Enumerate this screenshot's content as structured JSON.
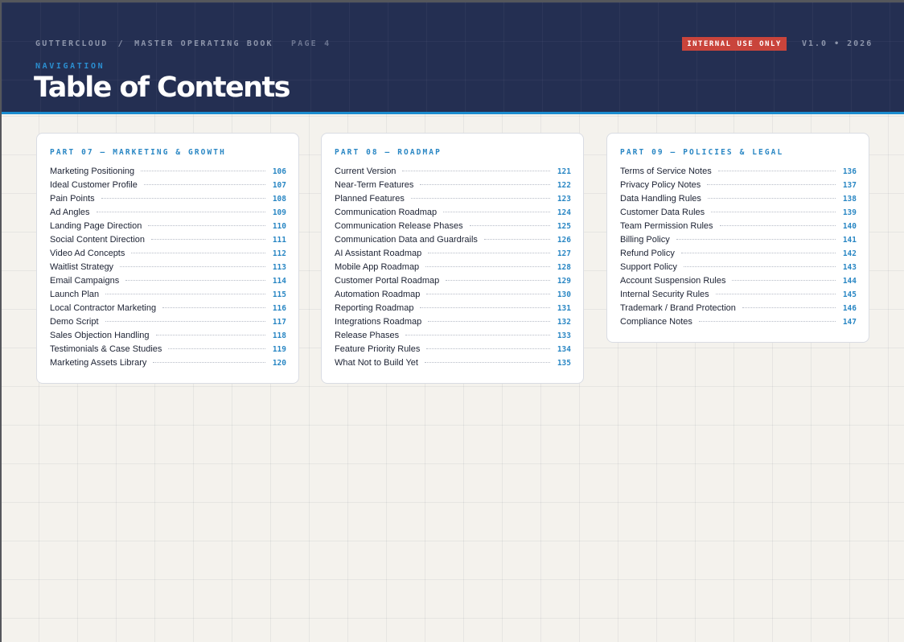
{
  "header": {
    "brand": "GUTTERCLOUD",
    "separator": "/",
    "book": "MASTER OPERATING BOOK",
    "page": "PAGE 4",
    "badge": "INTERNAL USE ONLY",
    "version": "V1.0 • 2026",
    "eyebrow": "NAVIGATION",
    "title": "Table of Contents"
  },
  "colors": {
    "header_bg": "#242f52",
    "accent_blue": "#2a87c4",
    "badge_red": "#c9443b",
    "page_bg": "#f4f2ed"
  },
  "parts": [
    {
      "title": "PART 07 — MARKETING & GROWTH",
      "items": [
        {
          "label": "Marketing Positioning",
          "page": "106"
        },
        {
          "label": "Ideal Customer Profile",
          "page": "107"
        },
        {
          "label": "Pain Points",
          "page": "108"
        },
        {
          "label": "Ad Angles",
          "page": "109"
        },
        {
          "label": "Landing Page Direction",
          "page": "110"
        },
        {
          "label": "Social Content Direction",
          "page": "111"
        },
        {
          "label": "Video Ad Concepts",
          "page": "112"
        },
        {
          "label": "Waitlist Strategy",
          "page": "113"
        },
        {
          "label": "Email Campaigns",
          "page": "114"
        },
        {
          "label": "Launch Plan",
          "page": "115"
        },
        {
          "label": "Local Contractor Marketing",
          "page": "116"
        },
        {
          "label": "Demo Script",
          "page": "117"
        },
        {
          "label": "Sales Objection Handling",
          "page": "118"
        },
        {
          "label": "Testimonials & Case Studies",
          "page": "119"
        },
        {
          "label": "Marketing Assets Library",
          "page": "120"
        }
      ]
    },
    {
      "title": "PART 08 — ROADMAP",
      "items": [
        {
          "label": "Current Version",
          "page": "121"
        },
        {
          "label": "Near-Term Features",
          "page": "122"
        },
        {
          "label": "Planned Features",
          "page": "123"
        },
        {
          "label": "Communication Roadmap",
          "page": "124"
        },
        {
          "label": "Communication Release Phases",
          "page": "125"
        },
        {
          "label": "Communication Data and Guardrails",
          "page": "126"
        },
        {
          "label": "AI Assistant Roadmap",
          "page": "127"
        },
        {
          "label": "Mobile App Roadmap",
          "page": "128"
        },
        {
          "label": "Customer Portal Roadmap",
          "page": "129"
        },
        {
          "label": "Automation Roadmap",
          "page": "130"
        },
        {
          "label": "Reporting Roadmap",
          "page": "131"
        },
        {
          "label": "Integrations Roadmap",
          "page": "132"
        },
        {
          "label": "Release Phases",
          "page": "133"
        },
        {
          "label": "Feature Priority Rules",
          "page": "134"
        },
        {
          "label": "What Not to Build Yet",
          "page": "135"
        }
      ]
    },
    {
      "title": "PART 09 — POLICIES & LEGAL",
      "items": [
        {
          "label": "Terms of Service Notes",
          "page": "136"
        },
        {
          "label": "Privacy Policy Notes",
          "page": "137"
        },
        {
          "label": "Data Handling Rules",
          "page": "138"
        },
        {
          "label": "Customer Data Rules",
          "page": "139"
        },
        {
          "label": "Team Permission Rules",
          "page": "140"
        },
        {
          "label": "Billing Policy",
          "page": "141"
        },
        {
          "label": "Refund Policy",
          "page": "142"
        },
        {
          "label": "Support Policy",
          "page": "143"
        },
        {
          "label": "Account Suspension Rules",
          "page": "144"
        },
        {
          "label": "Internal Security Rules",
          "page": "145"
        },
        {
          "label": "Trademark / Brand Protection",
          "page": "146"
        },
        {
          "label": "Compliance Notes",
          "page": "147"
        }
      ]
    }
  ]
}
